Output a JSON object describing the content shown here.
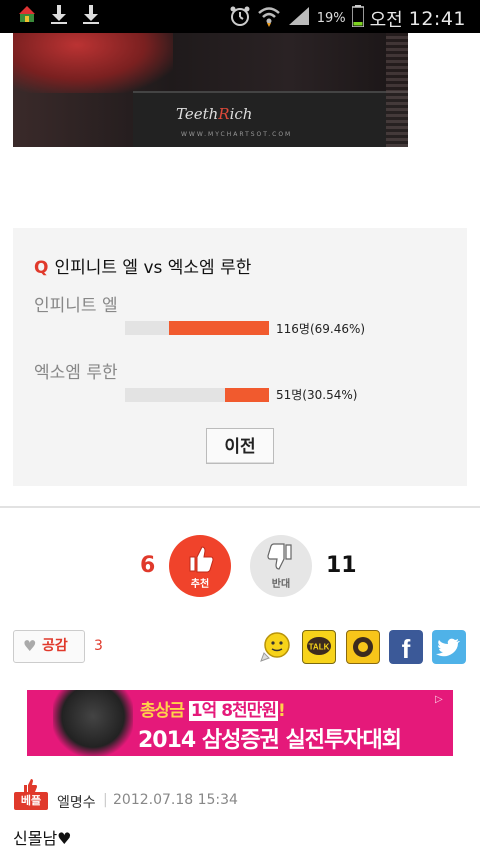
{
  "status_bar": {
    "battery": "19%",
    "ampm": "오전",
    "time": "12:41"
  },
  "hero": {
    "logo_prefix": "Teeth",
    "logo_accent": "R",
    "logo_suffix": "ich",
    "logo_sub": "WWW.MYCHARTSOT.COM"
  },
  "poll": {
    "q_mark": "Q",
    "question": "인피니트 엘 vs 엑소엠 루한",
    "options": [
      {
        "label": "인피니트 엘",
        "result": "116명(69.46%)",
        "percent": 69.46
      },
      {
        "label": "엑소엠 루한",
        "result": "51명(30.54%)",
        "percent": 30.54
      }
    ],
    "prev_button": "이전"
  },
  "vote": {
    "up_count": "6",
    "up_label": "추천",
    "down_label": "반대",
    "down_count": "11"
  },
  "empathy": {
    "button_label": "공감",
    "count": "3"
  },
  "share": {
    "talk_label": "TALK",
    "facebook_label": "f"
  },
  "ad": {
    "line1_pre": "총상금 ",
    "line1_highlight": "1억 8천만원",
    "line1_post": "!",
    "line2": "2014 삼성증권 실전투자대회"
  },
  "comment": {
    "badge": "베플",
    "author": "엘명수",
    "separator": "|",
    "date": "2012.07.18 15:34",
    "text": "신몰남♥"
  },
  "colors": {
    "accent": "#e0392b",
    "bar": "#f15a2e",
    "ad_bg": "#e5197a"
  }
}
